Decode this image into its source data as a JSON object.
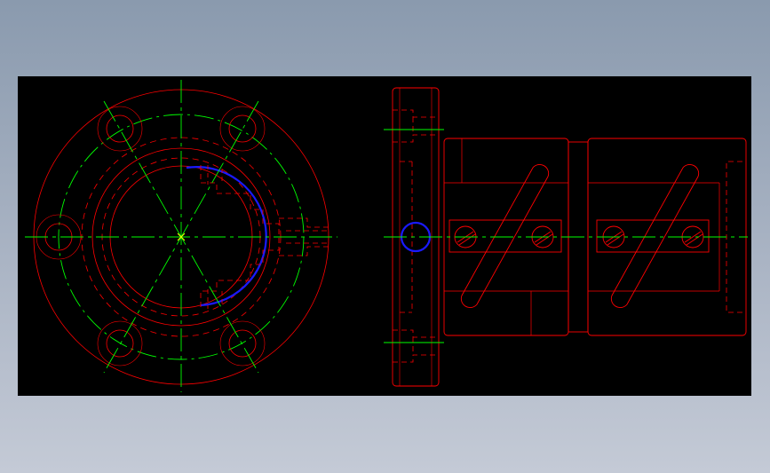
{
  "viewer": {
    "background_color": "#000000",
    "page_background": "#a4aec0"
  },
  "drawing": {
    "views": [
      "front-view-flange",
      "side-view-nut"
    ],
    "colors": {
      "outline": "#ff0000",
      "hidden": "#ff0000",
      "center": "#00ff00",
      "highlight": "#1a1aff",
      "marker": "#ffff00"
    },
    "icons": [
      "screw-head-icon",
      "bolt-hole-icon",
      "center-mark-icon"
    ]
  }
}
